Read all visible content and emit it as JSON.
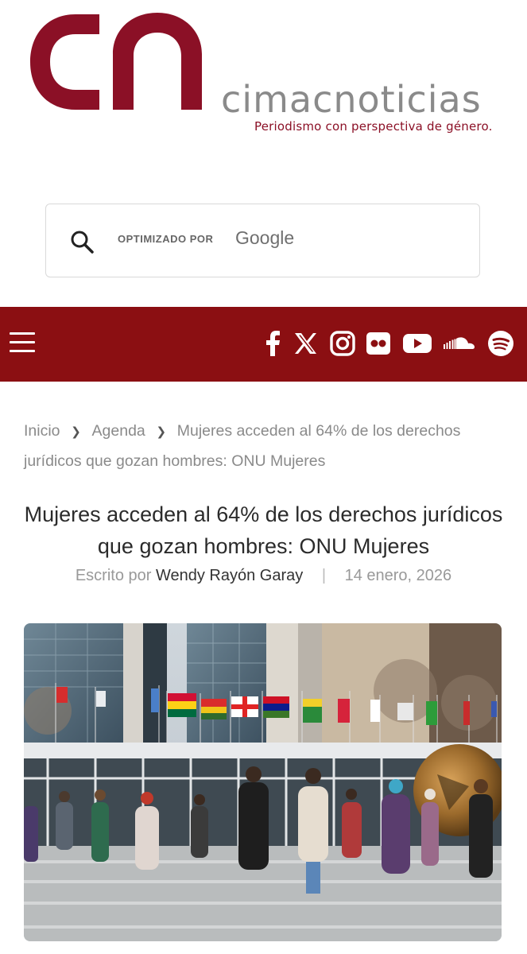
{
  "brand": {
    "logo_name": "cimacnoticias",
    "tagline": "Periodismo con perspectiva de género.",
    "logo_color": "#8b1026"
  },
  "search": {
    "powered_label": "OPTIMIZADO POR",
    "google_label": "Google"
  },
  "navbar": {
    "color": "#8b0f12",
    "social_icons": [
      "facebook-icon",
      "x-icon",
      "instagram-icon",
      "flickr-icon",
      "youtube-icon",
      "soundcloud-icon",
      "spotify-icon"
    ]
  },
  "breadcrumb": {
    "home": "Inicio",
    "section": "Agenda",
    "current": "Mujeres acceden al 64% de los derechos jurídicos que gozan hombres: ONU Mujeres"
  },
  "article": {
    "title": "Mujeres acceden al 64% de los derechos jurídicos que gozan hombres: ONU Mujeres",
    "written_by_label": "Escrito por",
    "author": "Wendy Rayón Garay",
    "date": "14 enero, 2026"
  }
}
